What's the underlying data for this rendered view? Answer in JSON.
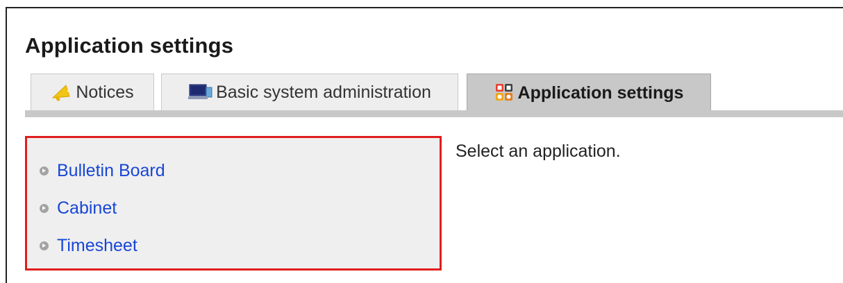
{
  "page": {
    "title": "Application settings"
  },
  "tabs": [
    {
      "label": "Notices",
      "icon": "megaphone-icon",
      "active": false
    },
    {
      "label": "Basic system administration",
      "icon": "computer-icon",
      "active": false
    },
    {
      "label": "Application settings",
      "icon": "apps-grid-icon",
      "active": true
    }
  ],
  "applications": [
    {
      "label": "Bulletin Board"
    },
    {
      "label": "Cabinet"
    },
    {
      "label": "Timesheet"
    }
  ],
  "hint": "Select an application.",
  "colors": {
    "link": "#1846d6",
    "highlight_border": "#e01d1d",
    "active_tab": "#c8c8c8",
    "inactive_tab": "#eeeeee",
    "list_background": "#efefef"
  }
}
